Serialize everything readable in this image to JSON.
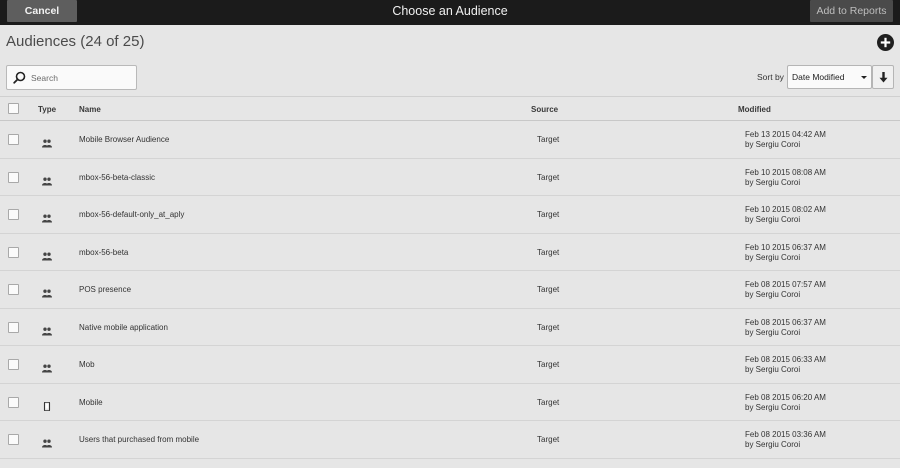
{
  "topbar": {
    "cancel_label": "Cancel",
    "title": "Choose an Audience",
    "add_label": "Add to Reports"
  },
  "header": {
    "title": "Audiences",
    "count": "(24 of 25)"
  },
  "search": {
    "placeholder": "Search",
    "value": ""
  },
  "sort": {
    "label": "Sort by",
    "selected": "Date Modified",
    "direction": "descending"
  },
  "table": {
    "columns": {
      "type": "Type",
      "name": "Name",
      "source": "Source",
      "modified": "Modified"
    },
    "rows": [
      {
        "icon": "group-icon",
        "name": "Mobile Browser Audience",
        "source": "Target",
        "date": "Feb 13 2015 04:42 AM",
        "by": "by Sergiu Coroi"
      },
      {
        "icon": "group-icon",
        "name": "mbox-56-beta-classic",
        "source": "Target",
        "date": "Feb 10 2015 08:08 AM",
        "by": "by Sergiu Coroi"
      },
      {
        "icon": "group-icon",
        "name": "mbox-56-default-only_at_aply",
        "source": "Target",
        "date": "Feb 10 2015 08:02 AM",
        "by": "by Sergiu Coroi"
      },
      {
        "icon": "group-icon",
        "name": "mbox-56-beta",
        "source": "Target",
        "date": "Feb 10 2015 06:37 AM",
        "by": "by Sergiu Coroi"
      },
      {
        "icon": "group-icon",
        "name": "POS presence",
        "source": "Target",
        "date": "Feb 08 2015 07:57 AM",
        "by": "by Sergiu Coroi"
      },
      {
        "icon": "group-icon",
        "name": "Native mobile application",
        "source": "Target",
        "date": "Feb 08 2015 06:37 AM",
        "by": "by Sergiu Coroi"
      },
      {
        "icon": "group-icon",
        "name": "Mob",
        "source": "Target",
        "date": "Feb 08 2015 06:33 AM",
        "by": "by Sergiu Coroi"
      },
      {
        "icon": "mobile-icon",
        "name": "Mobile",
        "source": "Target",
        "date": "Feb 08 2015 06:20 AM",
        "by": "by Sergiu Coroi"
      },
      {
        "icon": "group-icon",
        "name": "Users that purchased from mobile",
        "source": "Target",
        "date": "Feb 08 2015 03:36 AM",
        "by": "by Sergiu Coroi"
      }
    ]
  }
}
